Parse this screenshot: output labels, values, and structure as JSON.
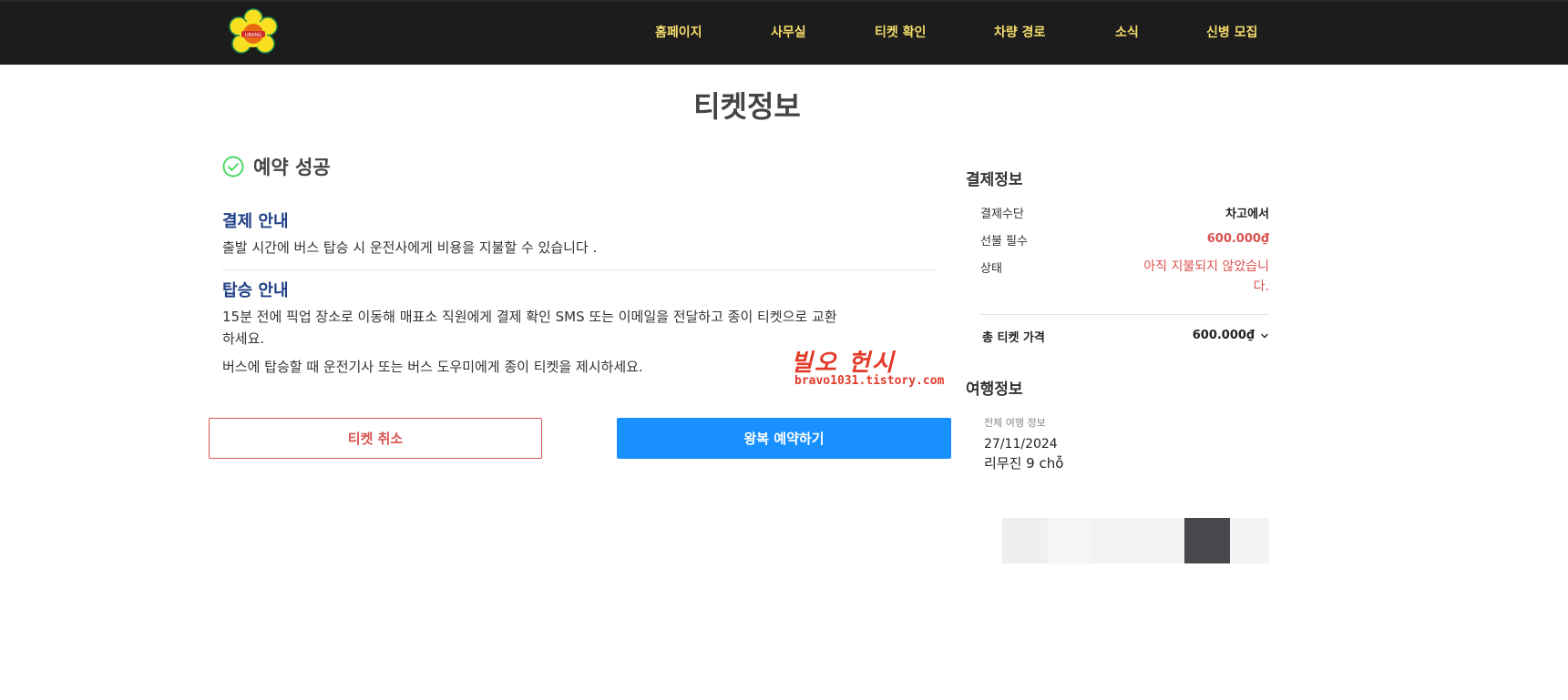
{
  "header": {
    "logo_icon": "flower-logo",
    "logo_text": "UBANG",
    "nav": [
      "홈페이지",
      "사무실",
      "티켓 확인",
      "차량 경로",
      "소식",
      "신병 모집"
    ]
  },
  "page_title": "티켓정보",
  "booking": {
    "status_icon": "check-circle-icon",
    "status_text": "예약 성공",
    "payment_heading": "결제 안내",
    "payment_text": "출발 시간에 버스 탑승 시 운전사에게 비용을 지불할 수 있습니다 .",
    "boarding_heading": "탑승 안내",
    "boarding_text_1": "15분 전에 픽업 장소로 이동해 매표소 직원에게 결제 확인 SMS 또는 이메일을 전달하고 종이 티켓으로 교환",
    "boarding_text_1b": "하세요.",
    "boarding_text_2": "버스에 탑승할 때 운전기사 또는 버스 도우미에게 종이 티켓을 제시하세요.",
    "cancel_button": "티켓 취소",
    "round_trip_button": "왕복 예약하기"
  },
  "watermark": {
    "line1": "빌오 헌시",
    "line2": "bravo1031.tistory.com"
  },
  "payment_info": {
    "heading": "결제정보",
    "method_label": "결제수단",
    "method_value": "차고에서",
    "prepay_label": "선불 필수",
    "prepay_value": "600.000₫",
    "status_label": "상태",
    "status_value_line1": "아직 지불되지 않았습니",
    "status_value_line2": "다.",
    "total_label": "총 티켓 가격",
    "total_value": "600.000₫"
  },
  "trip_info": {
    "heading": "여행정보",
    "subheading": "전체 여행 정보",
    "date": "27/11/2024",
    "vehicle": "리무진 9 chỗ"
  },
  "colors": {
    "header_bg": "#1c1c1c",
    "nav_text": "#f5dc6b",
    "heading_blue": "#1f3f86",
    "danger": "#d9534f",
    "primary": "#1890ff",
    "success": "#4cd964"
  },
  "color_blocks": [
    "#efeff1",
    "#f7f4f4",
    "#f3f2f2",
    "#f3f2f2",
    "#48484c",
    "#f4f4f4"
  ]
}
